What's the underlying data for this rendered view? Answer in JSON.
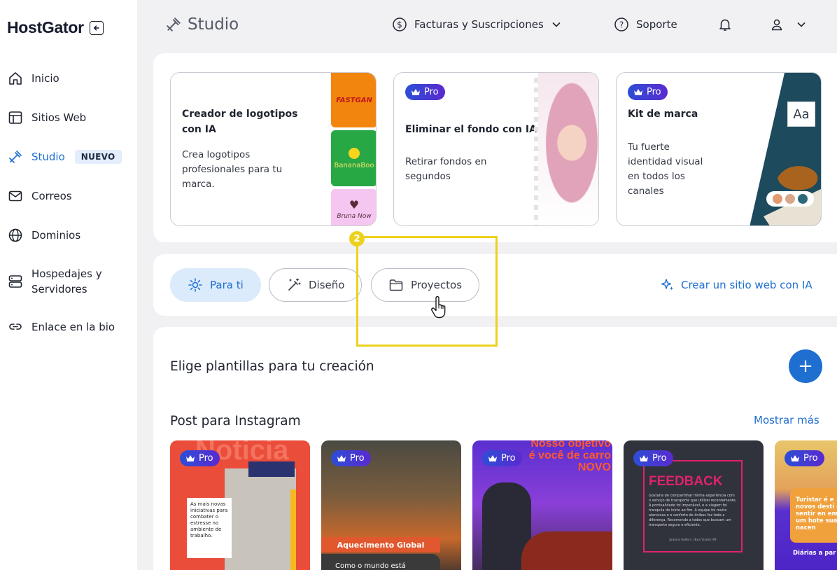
{
  "sidebar": {
    "logo": "HostGator",
    "items": [
      {
        "label": "Inicio"
      },
      {
        "label": "Sitios Web"
      },
      {
        "label": "Studio",
        "badge": "NUEVO"
      },
      {
        "label": "Correos"
      },
      {
        "label": "Dominios"
      },
      {
        "label": "Hospedajes y Servidores"
      },
      {
        "label": "Enlace en la bio"
      }
    ]
  },
  "header": {
    "title": "Studio",
    "billing": "Facturas y Suscripciones",
    "support": "Soporte"
  },
  "cards": [
    {
      "title": "Creador de logotipos con IA",
      "desc": "Crea logotipos profesionales para tu marca.",
      "logos": [
        "FASTGAN",
        "BananaBoo",
        "Bruna Now"
      ]
    },
    {
      "title": "Eliminar el fondo con IA",
      "desc": "Retirar fondos en segundos",
      "badge": "Pro"
    },
    {
      "title": "Kit de marca",
      "desc": "Tu fuerte identidad visual en todos los canales",
      "badge": "Pro",
      "font_sample": "Aa"
    }
  ],
  "filters": {
    "chips": [
      {
        "label": "Para ti",
        "active": true
      },
      {
        "label": "Diseño",
        "active": false
      },
      {
        "label": "Proyectos",
        "active": false
      }
    ],
    "ai_link": "Crear un sitio web con IA",
    "step": "2"
  },
  "templates": {
    "heading": "Elige plantillas para tu creación",
    "category": "Post para Instagram",
    "show_more": "Mostrar más",
    "badge": "Pro",
    "items": [
      {
        "headline": "Noticia",
        "text": "As mais novas iniciativas para combater o estresse no ambiente de trabalho."
      },
      {
        "headline": "Aquecimento Global",
        "text": "Como o mundo está"
      },
      {
        "headline": "Nosso objetivo é você de carro NOVO"
      },
      {
        "headline": "FEEDBACK",
        "text": "Gostaria de compartilhar minha experiência com o serviço de transporte que utilizei recentemente. A pontualidade foi impecável, e a viagem foi tranquila do início ao fim. A equipe foi muito atenciosa e o conforto do ônibus fez toda a diferença. Recomendo a todos que buscam um transporte seguro e eficiente.",
        "author": "Joanna Sellers | Bus Visitor 99"
      },
      {
        "headline": "Turistar é e novos desti se sentir en em um hote suas nacen",
        "footer": "Diárias a par"
      }
    ]
  },
  "colors": {
    "accent": "#1f6fd1",
    "highlight": "#ecd21e",
    "pro_start": "#2d4ed6",
    "pro_end": "#5a2ad0"
  }
}
